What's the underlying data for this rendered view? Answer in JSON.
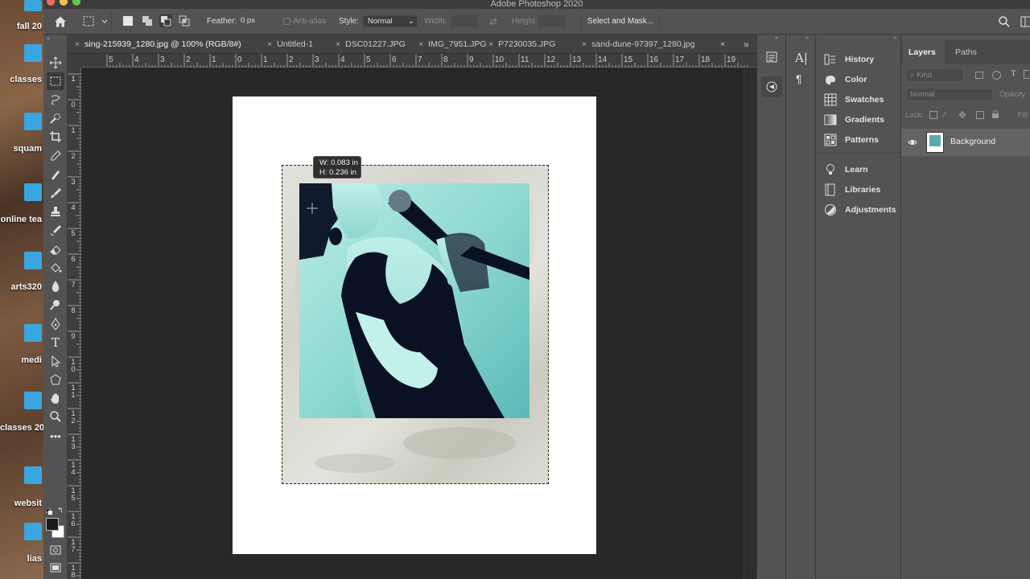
{
  "window": {
    "title": "Adobe Photoshop 2020"
  },
  "desktop": {
    "labels": [
      "fall 20",
      "classes",
      "squam",
      "online tea",
      "arts320",
      "medi",
      "classes 20",
      "websit",
      "lias"
    ]
  },
  "options_bar": {
    "feather_label": "Feather:",
    "feather_value": "0 px",
    "antialias_label": "Anti-alias",
    "style_label": "Style:",
    "style_value": "Normal",
    "width_label": "Width:",
    "height_label": "Height:",
    "select_mask_label": "Select and Mask..."
  },
  "tabs": [
    {
      "label": "sing-215939_1280.jpg @ 100% (RGB/8#)",
      "active": true
    },
    {
      "label": "Untitled-1",
      "active": false
    },
    {
      "label": "DSC01227.JPG",
      "active": false
    },
    {
      "label": "IMG_7951.JPG",
      "active": false
    },
    {
      "label": "P7230035.JPG",
      "active": false
    },
    {
      "label": "sand-dune-97397_1280.jpg",
      "active": false
    }
  ],
  "ruler": {
    "h_ticks": [
      "5",
      "4",
      "3",
      "2",
      "1",
      "0",
      "1",
      "2",
      "3",
      "4",
      "5",
      "6",
      "7",
      "8",
      "9",
      "10",
      "11",
      "12",
      "13",
      "14",
      "15",
      "16",
      "17",
      "18",
      "19"
    ],
    "v_ticks": [
      "1",
      "0",
      "1",
      "2",
      "3",
      "4",
      "5",
      "6",
      "7",
      "8",
      "9",
      "10",
      "11",
      "12",
      "13",
      "14",
      "15",
      "16",
      "17",
      "18"
    ]
  },
  "canvas": {
    "tooltip_w": "W: 0.083 in",
    "tooltip_h": "H: 0.236 in"
  },
  "panels": {
    "items": [
      {
        "label": "History",
        "icon": "history-icon"
      },
      {
        "label": "Color",
        "icon": "color-icon"
      },
      {
        "label": "Swatches",
        "icon": "swatches-icon"
      },
      {
        "label": "Gradients",
        "icon": "gradients-icon"
      },
      {
        "label": "Patterns",
        "icon": "patterns-icon"
      },
      {
        "label": "Learn",
        "icon": "learn-icon"
      },
      {
        "label": "Libraries",
        "icon": "libraries-icon"
      },
      {
        "label": "Adjustments",
        "icon": "adjustments-icon"
      }
    ]
  },
  "layers_panel": {
    "tab_layers": "Layers",
    "tab_paths": "Paths",
    "kind_placeholder": "Kind",
    "blend_mode": "Normal",
    "opacity_label": "Opacity",
    "lock_label": "Lock:",
    "fill_label": "Fill",
    "layer_name": "Background"
  },
  "colors": {
    "app_bg": "#535353",
    "workspace": "#282828",
    "accent_folder": "#3aa6e0"
  }
}
